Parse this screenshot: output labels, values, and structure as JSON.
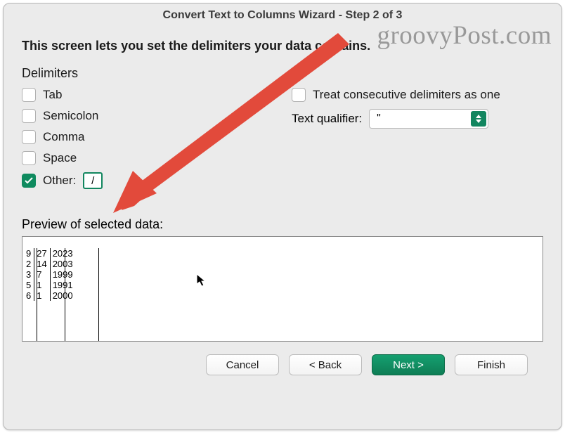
{
  "watermark": "groovyPost.com",
  "title": "Convert Text to Columns Wizard - Step 2 of 3",
  "intro": "This screen lets you set the delimiters your data contains.",
  "delimiters": {
    "heading": "Delimiters",
    "tab_label": "Tab",
    "semicolon_label": "Semicolon",
    "comma_label": "Comma",
    "space_label": "Space",
    "other_label": "Other:",
    "other_value": "/",
    "tab_checked": false,
    "semicolon_checked": false,
    "comma_checked": false,
    "space_checked": false,
    "other_checked": true
  },
  "options": {
    "treat_consecutive_label": "Treat consecutive delimiters as one",
    "treat_consecutive_checked": false,
    "text_qualifier_label": "Text qualifier:",
    "text_qualifier_value": "\""
  },
  "preview": {
    "label": "Preview of selected data:",
    "rows": [
      [
        "9",
        "27",
        "2023"
      ],
      [
        "2",
        "14",
        "2003"
      ],
      [
        "3",
        "7",
        "1999"
      ],
      [
        "5",
        "1",
        "1991"
      ],
      [
        "6",
        "1",
        "2000"
      ]
    ]
  },
  "buttons": {
    "cancel": "Cancel",
    "back": "< Back",
    "next": "Next >",
    "finish": "Finish"
  }
}
